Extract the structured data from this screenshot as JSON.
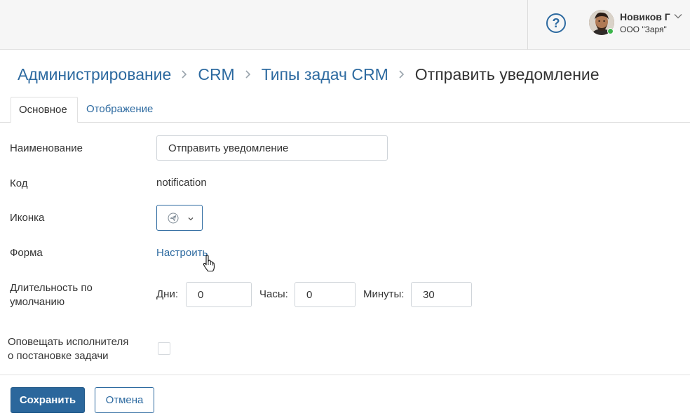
{
  "header": {
    "help_icon": "question-circle-icon",
    "help_label": "?",
    "user": {
      "name": "Новиков Г",
      "org": "ООО \"Заря\"",
      "status_color": "#3cb44b"
    }
  },
  "breadcrumb": {
    "items": [
      "Администрирование",
      "CRM",
      "Типы задач CRM"
    ],
    "current": "Отправить уведомление"
  },
  "tabs": {
    "main": "Основное",
    "display": "Отображение"
  },
  "form": {
    "name_label": "Наименование",
    "name_value": "Отправить уведомление",
    "code_label": "Код",
    "code_value": "notification",
    "icon_label": "Иконка",
    "icon_value": "paper-plane-icon",
    "form_label": "Форма",
    "form_link": "Настроить",
    "duration_label_line1": "Длительность по",
    "duration_label_line2": "умолчанию",
    "days_label": "Дни:",
    "days_value": "0",
    "hours_label": "Часы:",
    "hours_value": "0",
    "minutes_label": "Минуты:",
    "minutes_value": "30",
    "notify_label_line1": "Оповещать исполнителя",
    "notify_label_line2": "о постановке задачи",
    "notify_checked": false
  },
  "footer": {
    "save_label": "Сохранить",
    "cancel_label": "Отмена"
  },
  "colors": {
    "accent": "#2d6aa0",
    "primary_button": "#2b679c",
    "header_bg": "#f6f6f6"
  }
}
